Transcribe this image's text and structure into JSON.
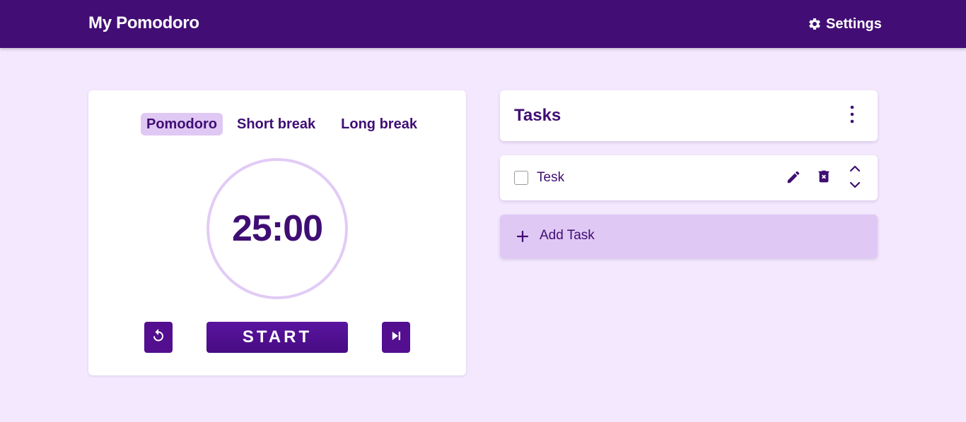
{
  "header": {
    "title": "My Pomodoro",
    "settings_label": "Settings",
    "settings_icon": "gear-icon"
  },
  "timer": {
    "modes": [
      {
        "label": "Pomodoro",
        "active": true
      },
      {
        "label": "Short break",
        "active": false
      },
      {
        "label": "Long break",
        "active": false
      }
    ],
    "time": "25:00",
    "start_label": "START",
    "reset_icon": "reset-icon",
    "skip_icon": "skip-next-icon"
  },
  "tasks": {
    "title": "Tasks",
    "menu_icon": "more-vertical-icon",
    "items": [
      {
        "name": "Tesk",
        "done": false
      }
    ],
    "add_label": "Add Task"
  },
  "colors": {
    "header_bg": "#420e75",
    "page_bg": "#f3e8fd",
    "accent": "#530f8f",
    "text": "#3f0e73",
    "active_tab_bg": "#e0c8f5",
    "ring": "#e2cbf6"
  }
}
